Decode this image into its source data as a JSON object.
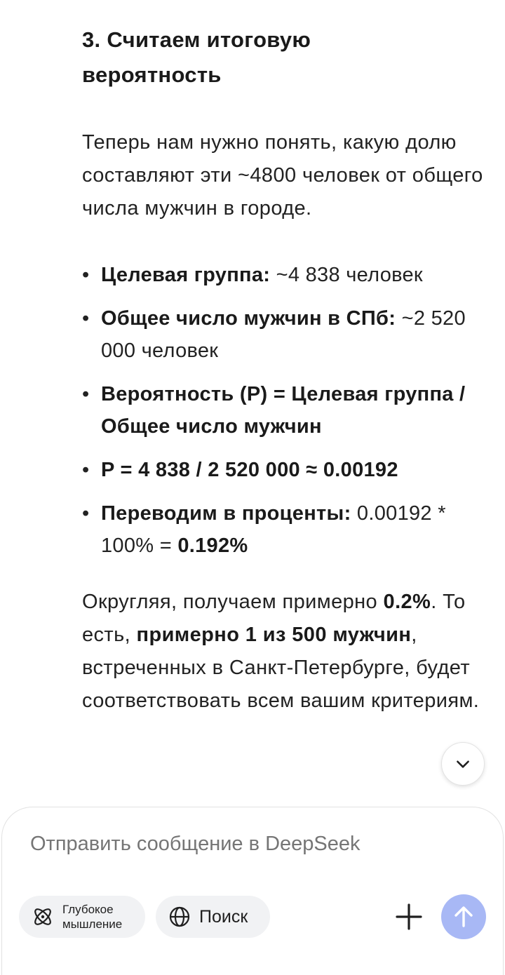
{
  "section": {
    "heading_line1": "3. Считаем итоговую",
    "heading_line2": "вероятность"
  },
  "paragraph1": "Теперь нам нужно понять, какую долю составляют эти ~4800 человек от общего числа мужчин в городе.",
  "bullets": [
    {
      "bold": "Целевая группа:",
      "text": " ~4 838 человек"
    },
    {
      "bold": "Общее число мужчин в СПб:",
      "text": " ~2 520 000 человек"
    },
    {
      "bold": "Вероятность (P) = Целевая группа / Общее число мужчин"
    },
    {
      "bold": "P = 4 838 / 2 520 000 ≈ 0.00192"
    },
    {
      "bold": "Переводим в проценты:",
      "text": " 0.00192 * 100% = ",
      "bold2": "0.192%"
    }
  ],
  "paragraph2": {
    "part1": "Округляя, получаем примерно ",
    "bold1": "0.2%",
    "part2": ". То есть, ",
    "bold2": "примерно 1 из 500 мужчин",
    "part3": ", встреченных в Санкт-Петербурге, будет соответствовать всем вашим критериям."
  },
  "composer": {
    "placeholder": "Отправить сообщение в DeepSeek",
    "deep_thinking_line1": "Глубокое",
    "deep_thinking_line2": "мышление",
    "search_label": "Поиск"
  },
  "icons": {
    "scroll_down": "chevron-down-icon",
    "deep_thinking": "atom-icon",
    "search": "globe-icon",
    "attach": "plus-icon",
    "send": "arrow-up-icon"
  },
  "colors": {
    "send_button": "#a8b8f5",
    "chip_bg": "#f1f2f4",
    "placeholder": "#a9a9a9"
  }
}
